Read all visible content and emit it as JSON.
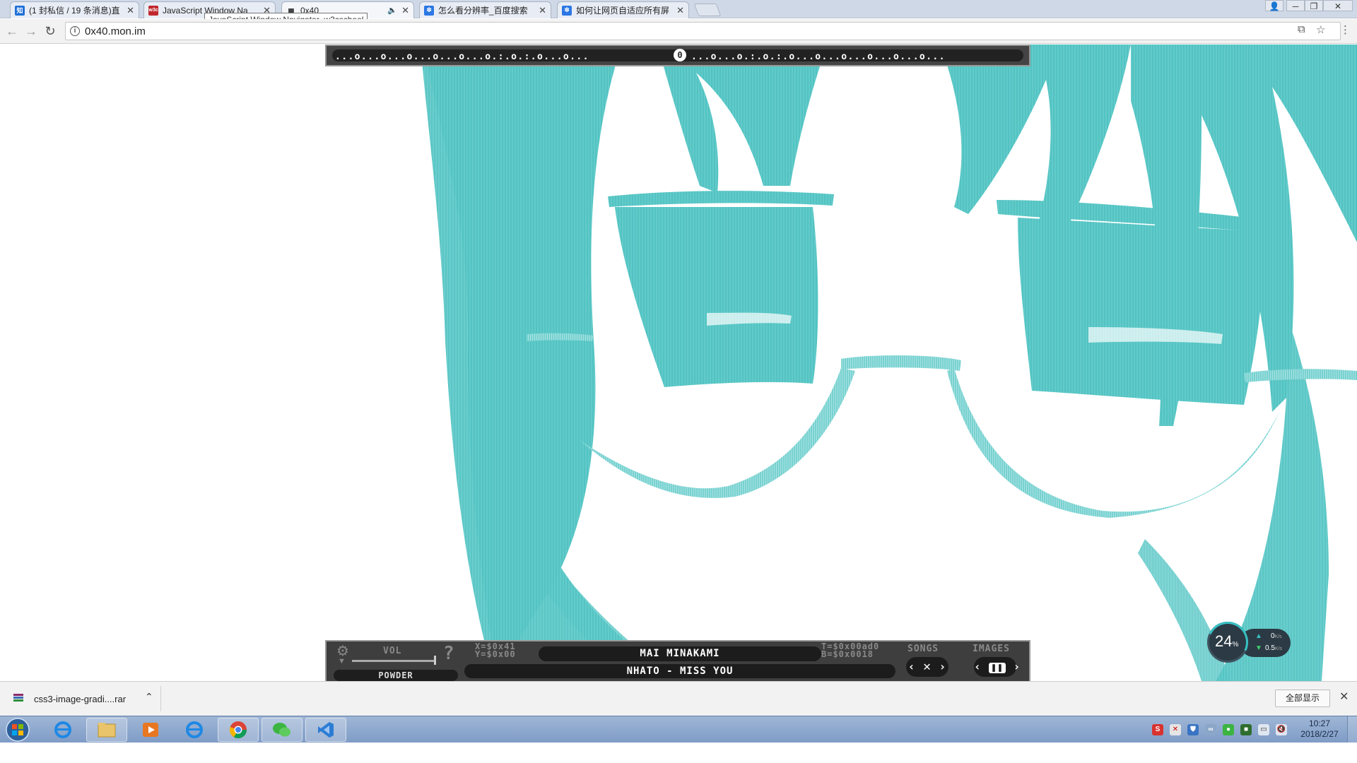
{
  "browser": {
    "tabs": [
      {
        "favicon": "zhihu-icon",
        "favicon_text": "知",
        "favicon_color": "#1e6fd9",
        "title": "(1 封私信 / 19 条消息)直",
        "active": false,
        "muted": false
      },
      {
        "favicon": "w3cschool-icon",
        "favicon_text": "w3c",
        "favicon_color": "#c0282d",
        "title": "JavaScript Window Na",
        "active": false,
        "muted": false
      },
      {
        "favicon": "page-icon",
        "favicon_text": "",
        "favicon_color": "#666666",
        "title": "0x40",
        "active": true,
        "muted": true
      },
      {
        "favicon": "baidu-icon",
        "favicon_text": "",
        "favicon_color": "#2b78e4",
        "title": "怎么看分辨率_百度搜索",
        "active": false,
        "muted": false
      },
      {
        "favicon": "baidu-icon",
        "favicon_text": "",
        "favicon_color": "#2b78e4",
        "title": "如何让网页自适应所有屏",
        "active": false,
        "muted": false
      }
    ],
    "tooltip": "JavaScript Window Navigator_w3cschool",
    "url": "0x40.mon.im"
  },
  "player": {
    "beat_left": "...o...o...o...o...o...o.:.o.:.o...o...",
    "beat_center": "0",
    "beat_right": "...o...o.:.o.:.o...o...o...o...o...o...",
    "vol_label": "VOL",
    "help_text": "?",
    "powder_label": "POWDER",
    "x_coord": "X=$0x41",
    "y_coord": "Y=$0x00",
    "artist": "MAI MINAKAMI",
    "song": "NHATO - MISS YOU",
    "t_coord": "T=$0x00ad0",
    "b_coord": "B=$0x0018",
    "songs_label": "SONGS",
    "images_label": "IMAGES",
    "shuffle_icon": "shuffle-icon",
    "pause_icon": "pause-icon",
    "accent_color": "#4ec1c0"
  },
  "netmonitor": {
    "percent": "24",
    "percent_unit": "%",
    "upload": "0",
    "download": "0.5",
    "unit": "K/s"
  },
  "downloads": {
    "file": "css3-image-gradi....rar",
    "show_all": "全部显示"
  },
  "taskbar": {
    "time": "10:27",
    "date": "2018/2/27",
    "apps": [
      "ie-icon",
      "explorer-icon",
      "media-player-icon",
      "ie-icon",
      "chrome-icon",
      "wechat-icon",
      "vscode-icon"
    ]
  }
}
